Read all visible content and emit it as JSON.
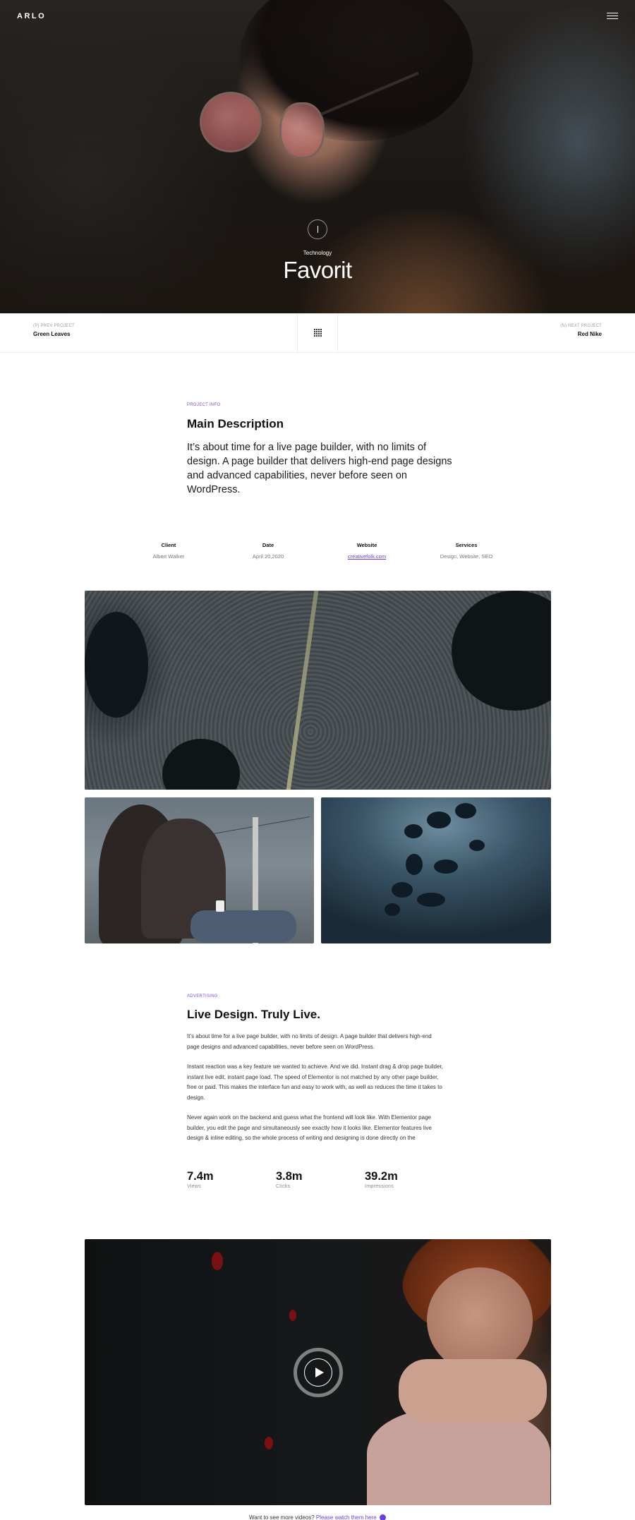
{
  "header": {
    "logo": "ARLO",
    "menu_icon": "hamburger-icon"
  },
  "hero": {
    "category": "Technology",
    "title": "Favorit",
    "scroll_icon": "scroll-down-icon"
  },
  "project_nav": {
    "prev_label": "(P) PREV PROJECT",
    "prev_name": "Green Leaves",
    "next_label": "(N) NEXT PROJECT",
    "next_name": "Red Nike",
    "grid_icon": "grid-icon"
  },
  "info": {
    "eyebrow": "PROJECT INFO",
    "title": "Main Description",
    "lead": "It’s about time for a live page builder, with no limits of design. A page builder that delivers high-end page designs and advanced capabilities, never before seen on WordPress.",
    "meta": [
      {
        "key": "Client",
        "value": "Albert Walker"
      },
      {
        "key": "Date",
        "value": "April 20,2020"
      },
      {
        "key": "Website",
        "value": "creativefolk.com"
      },
      {
        "key": "Services",
        "value": "Design, Website, SEO"
      }
    ]
  },
  "section2": {
    "eyebrow": "ADVERTISING",
    "title": "Live Design. Truly Live.",
    "paragraphs": [
      "It’s about time for a live page builder, with no limits of design. A page builder that delivers high-end page designs and advanced capabilities, never before seen on WordPress.",
      "Instant reaction was a key feature we wanted to achieve. And we did. Instant drag & drop page builder, instant live edit, instant page load. The speed of Elementor is not matched by any other page builder, free or paid. This makes the interface fun and easy to work with, as well as reduces the time it takes to design.",
      "Never again work on the backend and guess what the frontend will look like. With Elementor page builder, you edit the page and simultaneously see exactly how it looks like. Elementor features live design & inline editing, so the whole process of writing and designing is done directly on the"
    ],
    "stats": [
      {
        "number": "7.4m",
        "label": "Views"
      },
      {
        "number": "3.8m",
        "label": "Clicks"
      },
      {
        "number": "39.2m",
        "label": "Impressions"
      }
    ]
  },
  "video": {
    "play_icon": "play-icon",
    "more_text": "Want to see more videos?",
    "more_link": "Please watch them here"
  },
  "colors": {
    "accent": "#6a3fe0",
    "text": "#111111"
  }
}
